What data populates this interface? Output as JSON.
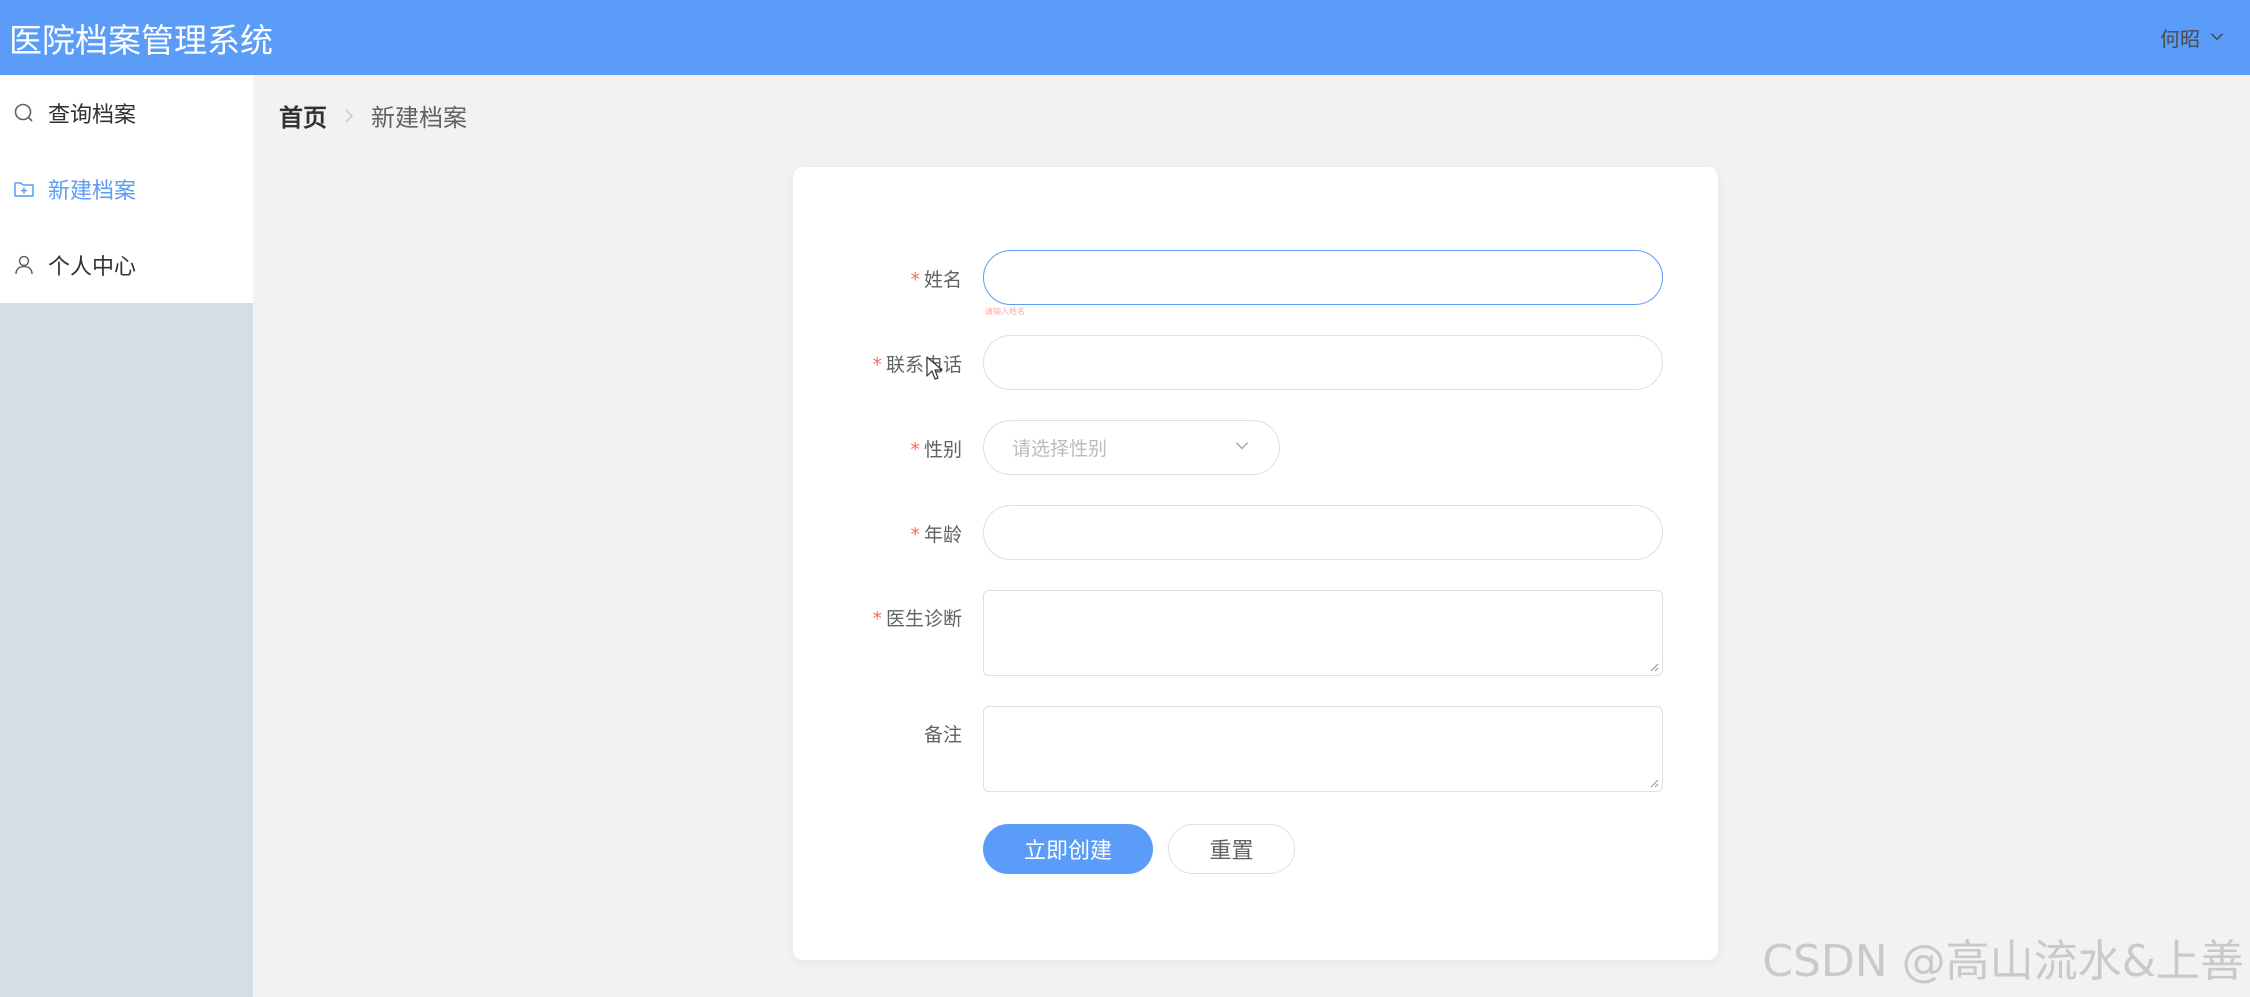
{
  "header": {
    "title": "医院档案管理系统",
    "user": "何昭",
    "bg_color": "#5a9cf8"
  },
  "sidebar": {
    "items": [
      {
        "label": "查询档案",
        "icon": "search-icon",
        "active": false
      },
      {
        "label": "新建档案",
        "icon": "folder-add-icon",
        "active": true
      },
      {
        "label": "个人中心",
        "icon": "user-icon",
        "active": false
      }
    ]
  },
  "breadcrumb": {
    "home": "首页",
    "current": "新建档案"
  },
  "form": {
    "name": {
      "label": "姓名",
      "required": true,
      "value": "",
      "error_hint": "请输入姓名"
    },
    "phone": {
      "label": "联系电话",
      "required": true,
      "value": ""
    },
    "gender": {
      "label": "性别",
      "required": true,
      "placeholder": "请选择性别"
    },
    "age": {
      "label": "年龄",
      "required": true,
      "value": ""
    },
    "diagnosis": {
      "label": "医生诊断",
      "required": true,
      "value": ""
    },
    "remark": {
      "label": "备注",
      "required": false,
      "value": ""
    },
    "submit_label": "立即创建",
    "reset_label": "重置",
    "required_mark": "*"
  },
  "watermark": "CSDN @高山流水&上善",
  "colors": {
    "primary": "#5a9cf8",
    "required": "#f56c6c",
    "sidebar_bg": "#d5dde6"
  }
}
